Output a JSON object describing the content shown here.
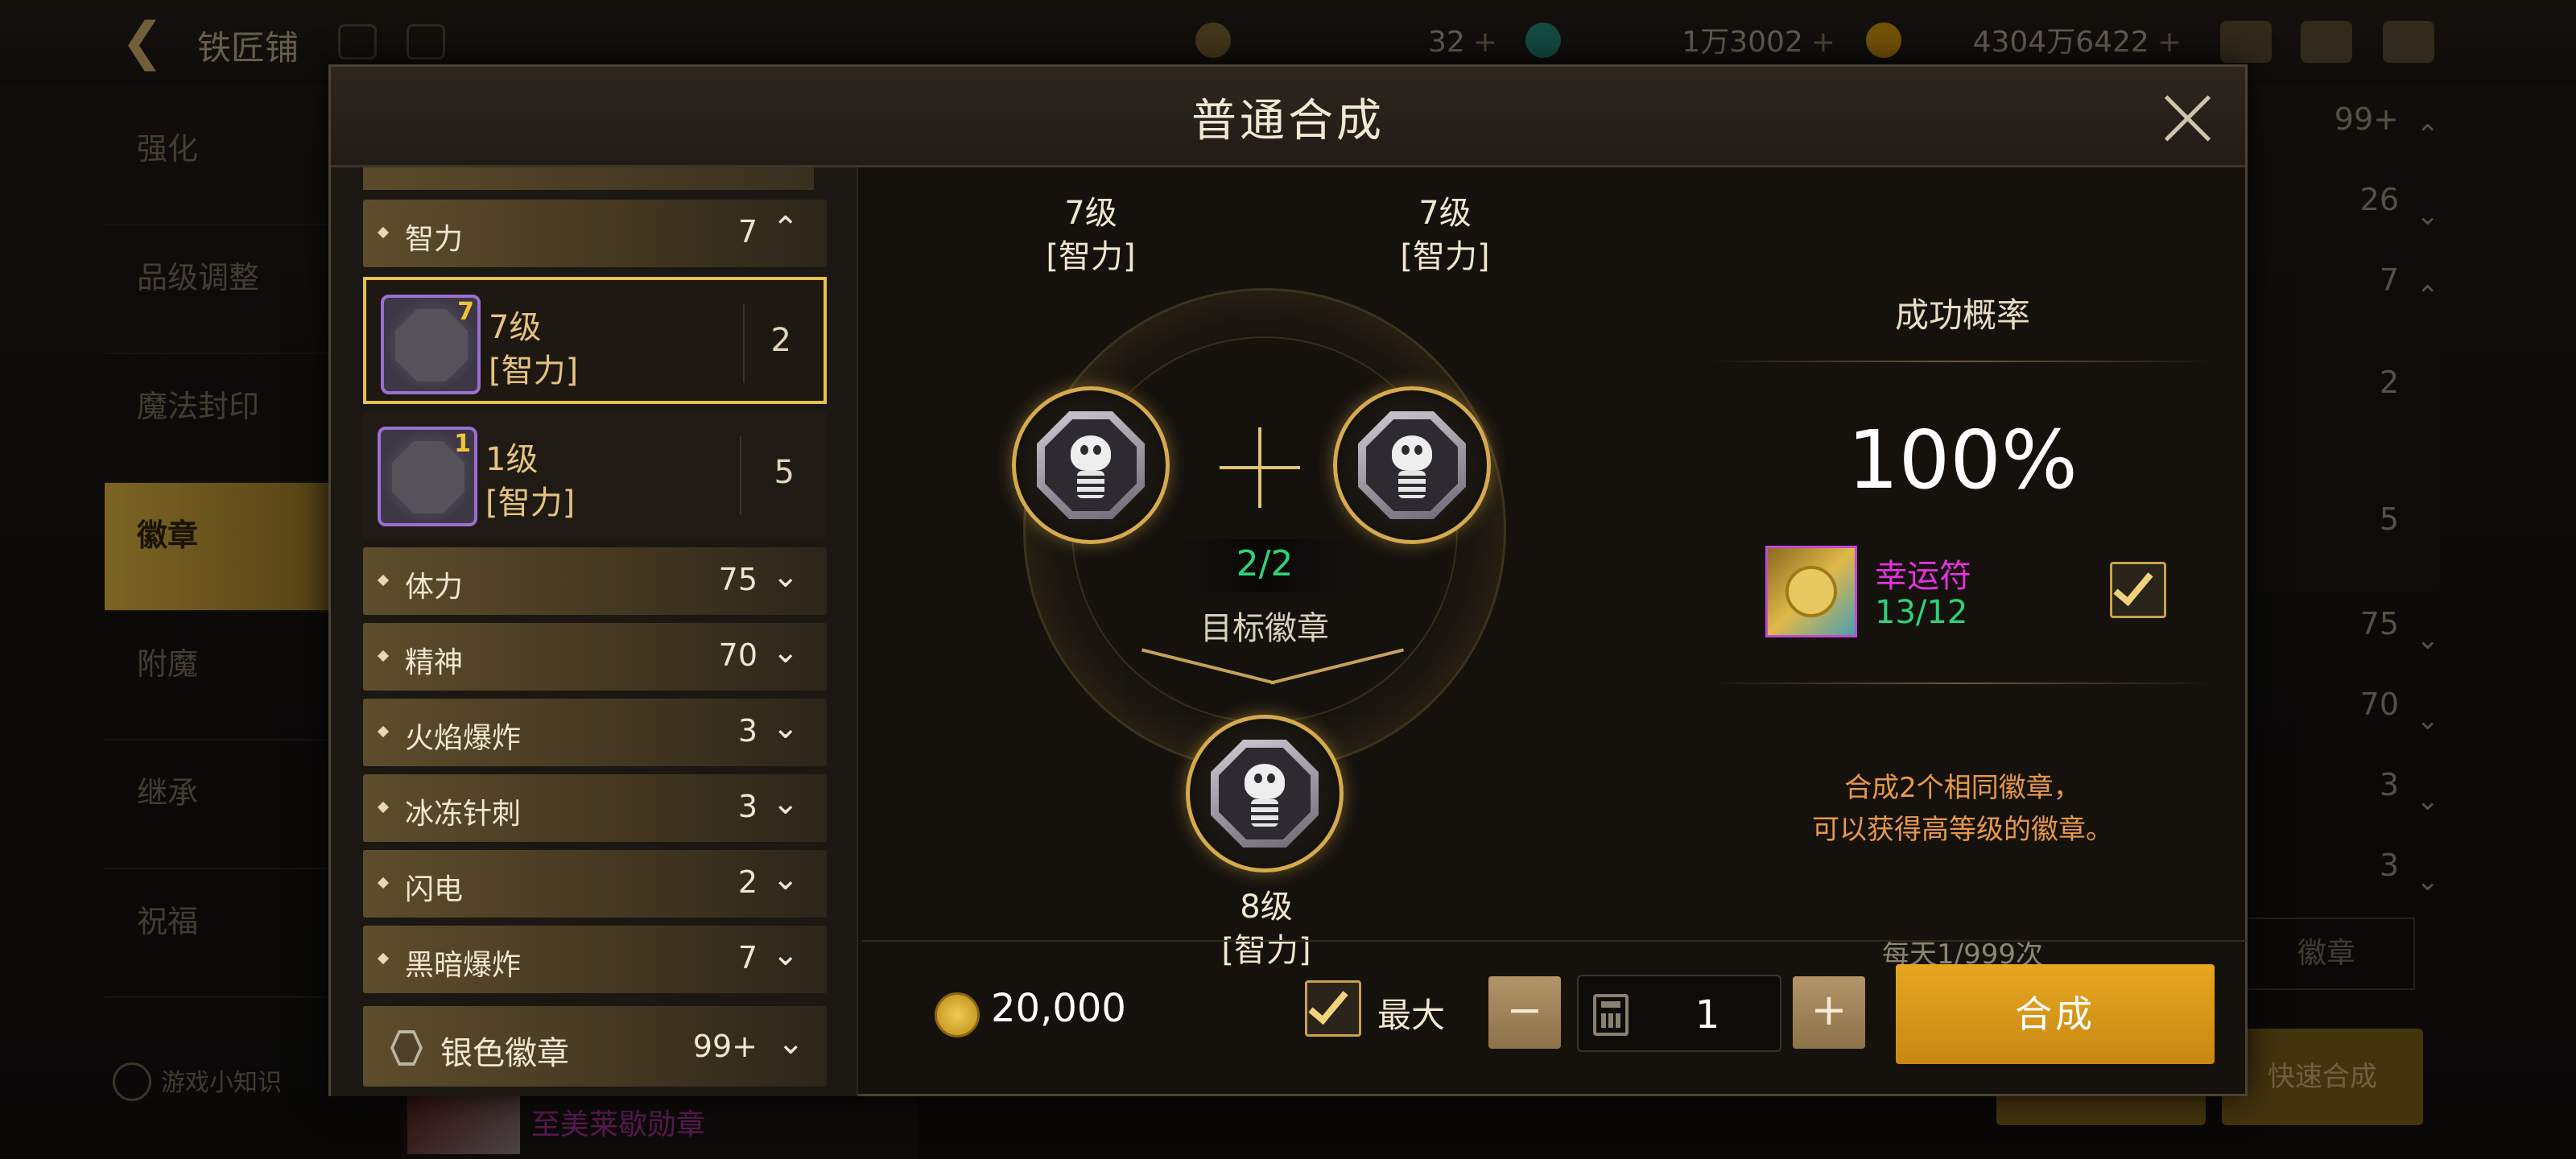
{
  "background": {
    "title": "铁匠铺",
    "resources": [
      {
        "value": "32",
        "icon": "moon-icon"
      },
      {
        "value": "1万3002",
        "icon": "crystal-icon"
      },
      {
        "value": "4304万6422",
        "icon": "gold-coin-icon"
      }
    ],
    "plus_glyph": "+",
    "nav": [
      "强化",
      "品级调整",
      "魔法封印",
      "徽章",
      "附魔",
      "继承",
      "祝福"
    ],
    "active_nav_index": 3,
    "help_label": "游戏小知识",
    "bottom_item_label": "至美莱歇勋章",
    "right_counts": [
      "99+",
      "26",
      "7",
      "2",
      "5",
      "75",
      "70",
      "3",
      "3"
    ],
    "right_button_1": "徽章",
    "right_button_2": "快速合成"
  },
  "modal": {
    "title": "普通合成",
    "categories_top": [
      {
        "label": "智力",
        "count": "7",
        "expanded": true
      }
    ],
    "items": [
      {
        "level": "7级",
        "attr": "[智力]",
        "count": "2",
        "selected": true,
        "badge": "7"
      },
      {
        "level": "1级",
        "attr": "[智力]",
        "count": "5",
        "selected": false,
        "badge": "1"
      }
    ],
    "categories": [
      {
        "label": "体力",
        "count": "75"
      },
      {
        "label": "精神",
        "count": "70"
      },
      {
        "label": "火焰爆炸",
        "count": "3"
      },
      {
        "label": "冰冻针刺",
        "count": "3"
      },
      {
        "label": "闪电",
        "count": "2"
      },
      {
        "label": "黑暗爆炸",
        "count": "7"
      }
    ],
    "silver": {
      "label": "银色徽章",
      "count": "99+"
    },
    "synthesis": {
      "input_left": {
        "level": "7级",
        "attr": "[智力]"
      },
      "input_right": {
        "level": "7级",
        "attr": "[智力]"
      },
      "progress": "2/2",
      "target_label": "目标徽章",
      "output": {
        "level": "8级",
        "attr": "[智力]"
      }
    },
    "rate": {
      "title": "成功概率",
      "value": "100%",
      "charm_name": "幸运符",
      "charm_count": "13/12",
      "charm_checked": true,
      "description_1": "合成2个相同徽章，",
      "description_2": "可以获得高等级的徽章。",
      "daily": "每天1/999次"
    },
    "footer": {
      "cost": "20,000",
      "max_label": "最大",
      "max_checked": true,
      "minus": "−",
      "plus": "+",
      "quantity": "1",
      "craft_label": "合成"
    }
  },
  "colors": {
    "accent_gold": "#e6c24d",
    "success_green": "#2ed27b",
    "charm_magenta": "#e332de",
    "desc_orange": "#e7984a",
    "craft_button": "#dc9a1a"
  }
}
